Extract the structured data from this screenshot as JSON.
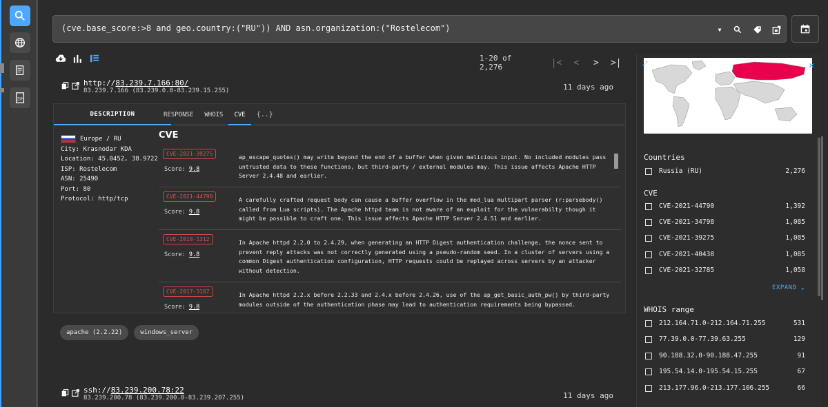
{
  "search": {
    "query": "(cve.base_score:>8 and geo.country:(\"RU\")) AND asn.organization:(\"Rostelecom\")"
  },
  "pager": {
    "range": "1-20 of 2,276",
    "first": "|<",
    "prev": "<",
    "next": ">",
    "last": ">|"
  },
  "results": [
    {
      "url_prefix": "http://",
      "url_host": "83.239.7.166:80/",
      "subtitle": "83.239.7.166 (83.239.0.0-83.239.15.255)",
      "ago": "11 days ago"
    },
    {
      "url_prefix": "ssh://",
      "url_host": "83.239.200.78:22",
      "subtitle": "83.239.200.78 (83.239.200.0-83.239.207.255)",
      "ago": "11 days ago"
    }
  ],
  "tabs": {
    "description": "DESCRIPTION",
    "response": "RESPONSE",
    "whois": "WHOIS",
    "cve": "CVE",
    "json": "{..}"
  },
  "info": {
    "region": "Europe / RU",
    "city": "City: Krasnodar KDA",
    "location": "Location: 45.0452, 38.9722",
    "isp": "ISP: Rostelecom",
    "asn": "ASN: 25490",
    "port": "Port: 80",
    "protocol": "Protocol: http/tcp"
  },
  "cve_section": {
    "title": "CVE",
    "score_label": "Score:",
    "items": [
      {
        "id": "CVE-2021-39275",
        "score": "9.8",
        "desc": "ap_escape_quotes() may write beyond the end of a buffer when given malicious input. No included modules pass untrusted data to these functions, but third-party / external modules may. This issue affects Apache HTTP Server 2.4.48 and earlier."
      },
      {
        "id": "CVE-2021-44790",
        "score": "9.8",
        "desc": "A carefully crafted request body can cause a buffer overflow in the mod_lua multipart parser (r:parsebody() called from Lua scripts). The Apache httpd team is not aware of an exploit for the vulnerabilty though it might be possible to craft one. This issue affects Apache HTTP Server 2.4.51 and earlier."
      },
      {
        "id": "CVE-2018-1312",
        "score": "9.8",
        "desc": "In Apache httpd 2.2.0 to 2.4.29, when generating an HTTP Digest authentication challenge, the nonce sent to prevent reply attacks was not correctly generated using a pseudo-random seed. In a cluster of servers using a common Digest authentication configuration, HTTP requests could be replayed across servers by an attacker without detection."
      },
      {
        "id": "CVE-2017-3167",
        "score": "9.8",
        "desc": "In Apache httpd 2.2.x before 2.2.33 and 2.4.x before 2.4.26, use of the ap_get_basic_auth_pw() by third-party modules outside of the authentication phase may lead to authentication requirements being bypassed."
      }
    ]
  },
  "tags": [
    "apache (2.2.22)",
    "windows_server"
  ],
  "side": {
    "countries_title": "Countries",
    "countries": [
      {
        "label": "Russia (RU)",
        "count": "2,276"
      }
    ],
    "cve_title": "CVE",
    "cves": [
      {
        "label": "CVE-2021-44790",
        "count": "1,392"
      },
      {
        "label": "CVE-2021-34798",
        "count": "1,085"
      },
      {
        "label": "CVE-2021-39275",
        "count": "1,085"
      },
      {
        "label": "CVE-2021-40438",
        "count": "1,085"
      },
      {
        "label": "CVE-2021-32785",
        "count": "1,058"
      }
    ],
    "expand": "EXPAND",
    "whois_title": "WHOIS range",
    "whois": [
      {
        "label": "212.164.71.0-212.164.71.255",
        "count": "531"
      },
      {
        "label": "77.39.0.0-77.39.63.255",
        "count": "129"
      },
      {
        "label": "90.188.32.0-90.188.47.255",
        "count": "91"
      },
      {
        "label": "195.54.14.0-195.54.15.255",
        "count": "67"
      },
      {
        "label": "213.177.96.0-213.177.106.255",
        "count": "66"
      }
    ]
  },
  "colors": {
    "accent": "#4da8ff",
    "cve_red": "#d24545",
    "highlight_country": "#e8004c",
    "map_land": "#d8d8d8",
    "map_bg": "#ffffff"
  },
  "icons": [
    "search-icon",
    "globe-icon",
    "document-icon",
    "zip-icon",
    "calendar-icon",
    "tag-icon",
    "export-icon",
    "cloud-download-icon",
    "bar-chart-icon",
    "list-view-icon",
    "copy-icon",
    "external-link-icon",
    "close-icon",
    "expand-icon",
    "chevron-down-icon"
  ]
}
